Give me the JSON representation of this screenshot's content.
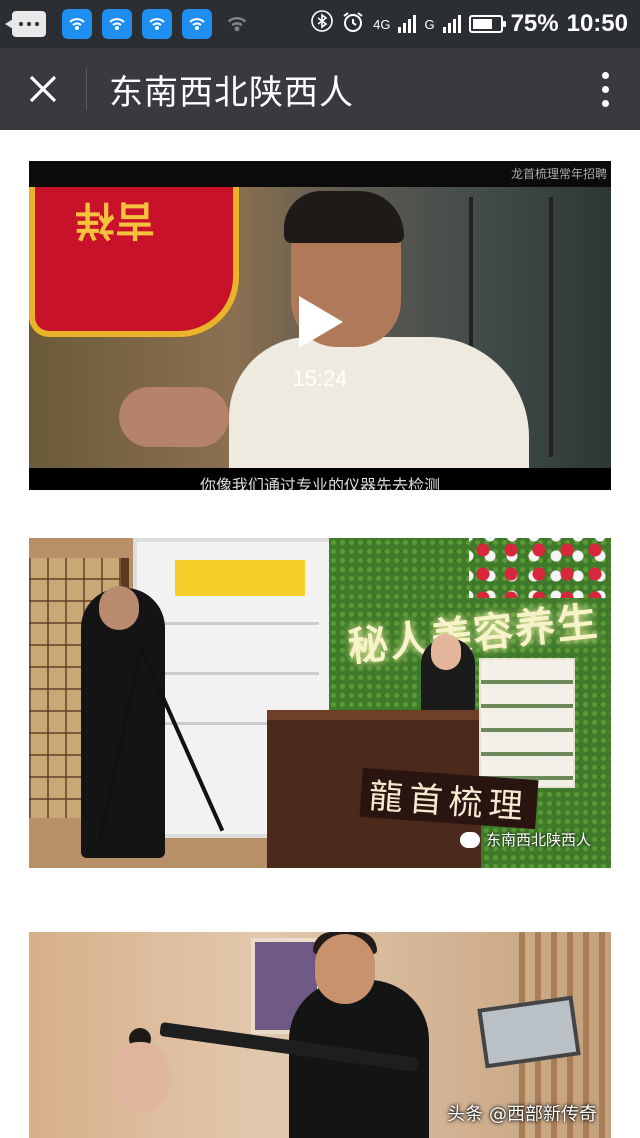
{
  "status_bar": {
    "icons": [
      "message-icon",
      "wifi-app-icon",
      "wifi-app-icon",
      "wifi-app-icon",
      "wifi-app-icon",
      "wifi-icon"
    ],
    "right_icons": [
      "bluetooth-icon",
      "alarm-icon",
      "signal-icon",
      "signal-icon",
      "battery-icon"
    ],
    "network_1": "4G",
    "network_2": "G",
    "battery": "75%",
    "battery_level": 0.75,
    "time": "10:50"
  },
  "app_bar": {
    "title": "东南西北陕西人",
    "close_icon": "close-icon",
    "menu_icon": "more-vertical-icon"
  },
  "video": {
    "duration": "15:24",
    "subtitle": "你像我们通过专业的仪器先去检测",
    "corner_text": "龙首梳理常年招聘",
    "banner_text": "吉祥"
  },
  "photo2": {
    "wall_sign": "秘人美容养生",
    "desk_label": "龍首梳理",
    "watermark": "东南西北陕西人"
  },
  "photo3": {
    "watermark": "头条 @西部新传奇"
  },
  "colors": {
    "status_bar_bg": "#2b2f33",
    "app_bar_bg": "#393a3f",
    "accent_blue": "#1f8ef1"
  }
}
